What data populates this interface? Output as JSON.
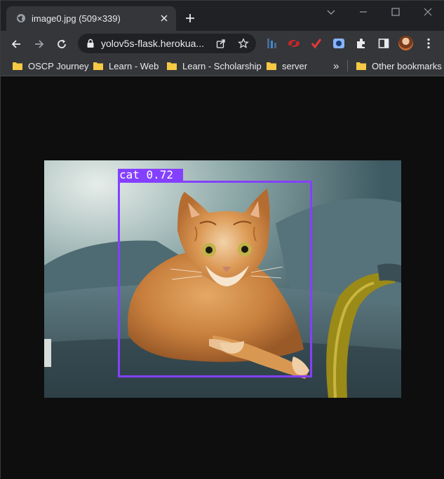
{
  "browser": {
    "tab": {
      "title": "image0.jpg (509×339)"
    },
    "address_bar": {
      "url": "yolov5s-flask.herokua..."
    },
    "bookmarks": [
      {
        "label": "OSCP Journey"
      },
      {
        "label": "Learn - Web"
      },
      {
        "label": "Learn - Scholarship"
      },
      {
        "label": "server"
      }
    ],
    "overflow_label": "»",
    "other_bookmarks_label": "Other bookmarks"
  },
  "detection": {
    "label": "cat 0.72",
    "class": "cat",
    "confidence": 0.72,
    "box_color": "#8440ff"
  },
  "colors": {
    "tabstrip": "#202124",
    "toolbar": "#35363a",
    "page_background": "#0e0e0e"
  },
  "icons": [
    "globe-icon",
    "close-icon",
    "plus-icon",
    "chevron-down-icon",
    "minimize-icon",
    "maximize-icon",
    "back-icon",
    "forward-icon",
    "reload-icon",
    "lock-icon",
    "share-icon",
    "star-icon",
    "extension-icon",
    "puzzle-icon",
    "side-panel-icon",
    "menu-icon",
    "folder-icon"
  ]
}
